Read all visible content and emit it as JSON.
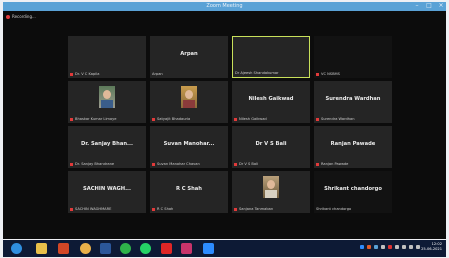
{
  "window": {
    "title": "Zoom Meeting",
    "controls": [
      "minimize",
      "maximize",
      "close"
    ]
  },
  "recording": {
    "label": "Recording..."
  },
  "tiles": [
    {
      "name": "",
      "label": "Dr. V C Kapila",
      "photo": false,
      "active": false
    },
    {
      "name": "Arpan",
      "label": "Arpan",
      "photo": false,
      "active": false
    },
    {
      "name": "",
      "label": "Dr Ajeesh Shandakumar",
      "photo": false,
      "active": true
    },
    {
      "name": "",
      "label": "VC NSBMS",
      "photo": false,
      "active": false,
      "dark": true
    },
    {
      "name": "",
      "label": "Bhaskar Kumar Limaye",
      "photo": true,
      "active": false
    },
    {
      "name": "",
      "label": "Satyajit Bhadauria",
      "photo": true,
      "active": false
    },
    {
      "name": "Nilesh Gaikwad",
      "label": "Nilesh Gaikwad",
      "photo": false,
      "active": false
    },
    {
      "name": "Surendra Wardhan",
      "label": "Surendra Wardhan",
      "photo": false,
      "active": false
    },
    {
      "name": "Dr. Sanjay Bhan...",
      "label": "Dr. Sanjay Bhandrane",
      "photo": false,
      "active": false
    },
    {
      "name": "Suvan Manohar...",
      "label": "Suvan Manohar Chavan",
      "photo": false,
      "active": false
    },
    {
      "name": "Dr V S Bali",
      "label": "Dr V S Bali",
      "photo": false,
      "active": false
    },
    {
      "name": "Ranjan Pawade",
      "label": "Ranjan Pawade",
      "photo": false,
      "active": false
    },
    {
      "name": "SACHIN WAGH...",
      "label": "SACHIN WAGHMARE",
      "photo": false,
      "active": false
    },
    {
      "name": "R C Shah",
      "label": "R C Shah",
      "photo": false,
      "active": false
    },
    {
      "name": "",
      "label": "Sanjana Tanmaban",
      "photo": true,
      "active": false
    },
    {
      "name": "Shrikant chandorgo",
      "label": "Shrikant chandorgo",
      "photo": false,
      "active": false,
      "dark": true
    }
  ],
  "taskbar": {
    "icons": [
      {
        "name": "start-icon",
        "color": "#2f8fe0"
      },
      {
        "name": "file-explorer-icon",
        "color": "#e8c04a"
      },
      {
        "name": "powerpoint-icon",
        "color": "#d24726"
      },
      {
        "name": "chrome-icon",
        "color": "#e8b04a"
      },
      {
        "name": "word-icon",
        "color": "#2b579a"
      },
      {
        "name": "green-app-icon",
        "color": "#2fb34a"
      },
      {
        "name": "whatsapp-icon",
        "color": "#25d366"
      },
      {
        "name": "youtube-icon",
        "color": "#e02626"
      },
      {
        "name": "photos-icon",
        "color": "#c8346b"
      },
      {
        "name": "zoom-icon",
        "color": "#2d8cff"
      }
    ],
    "clock": {
      "time": "12:02",
      "date": "25-06-2021"
    }
  }
}
